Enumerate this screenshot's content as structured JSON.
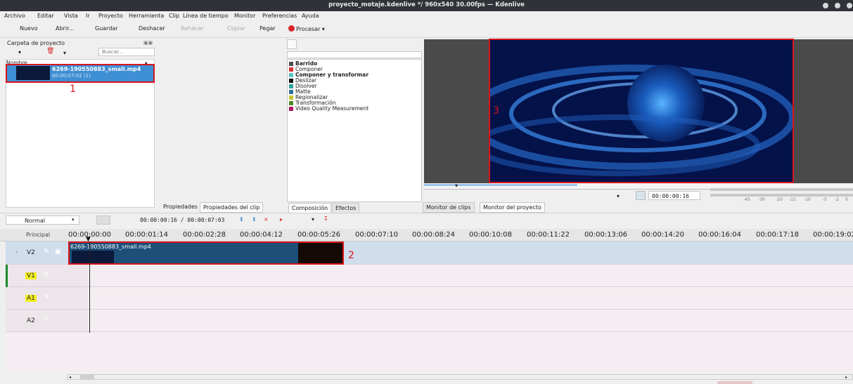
{
  "window": {
    "title": "proyecto_motaje.kdenlive */ 960x540 30.00fps — Kdenlive"
  },
  "menu": [
    "Archivo",
    "Editar",
    "Vista",
    "Ir",
    "Proyecto",
    "Herramienta",
    "Clip",
    "Línea de tiempo",
    "Monitor",
    "Preferencias",
    "Ayuda"
  ],
  "toolbar": {
    "nuevo": "Nuevo",
    "abrir": "Abrir...",
    "guardar": "Guardar",
    "deshacer": "Deshacer",
    "rehacer": "Rehacer",
    "copiar": "Copiar",
    "pegar": "Pegar",
    "procesar": "Procesar"
  },
  "bin": {
    "title": "Carpeta de proyecto",
    "search_placeholder": "Buscar...",
    "column": "Nombre",
    "clip_name": "6269-190550883_small.mp4",
    "clip_duration": "00:00:07:02 (1)"
  },
  "effects": {
    "items": [
      {
        "label": "Barrido",
        "bold": true,
        "color": "#4a4a4a"
      },
      {
        "label": "Componer",
        "bold": false,
        "color": "#d93030"
      },
      {
        "label": "Componer y transformar",
        "bold": true,
        "color": "#58c4c8"
      },
      {
        "label": "Deslizar",
        "bold": false,
        "color": "#111111"
      },
      {
        "label": "Disolver",
        "bold": false,
        "color": "#2aa39a"
      },
      {
        "label": "Matte",
        "bold": false,
        "color": "#2f6f9e"
      },
      {
        "label": "Regionalizar",
        "bold": false,
        "color": "#c8c830"
      },
      {
        "label": "Transformación",
        "bold": false,
        "color": "#4a8a2a"
      },
      {
        "label": "Video Quality Measurement",
        "bold": false,
        "color": "#b0155e"
      }
    ]
  },
  "tabs": {
    "propiedades": "Propiedades",
    "propiedades_clip": "Propiedades del clip",
    "composicion": "Composición",
    "efectos": "Efectos",
    "monitor_clips": "Monitor de clips",
    "monitor_proyecto": "Monitor del proyecto"
  },
  "monitor": {
    "timecode": "00:00:00:16",
    "audio_scale": [
      "-45",
      "-30",
      "-20",
      "-15",
      "-10",
      "-5",
      "-2",
      "0"
    ]
  },
  "timeline": {
    "mode": "Normal",
    "position": "00:00:00:16 / 00:00:07:03",
    "label": "Principal",
    "ruler": [
      "00:00:00:00",
      "00:00:01:14",
      "00:00:02:28",
      "00:00:04:12",
      "00:00:05:26",
      "00:00:07:10",
      "00:00:08:24",
      "00:00:10:08",
      "00:00:11:22",
      "00:00:13:06",
      "00:00:14:20",
      "00:00:16:04",
      "00:00:17:18",
      "00:00:19:02"
    ],
    "tracks": [
      "V2",
      "V1",
      "A1",
      "A2"
    ],
    "clip_label": "6269-190550883_small.mp4"
  },
  "annotations": [
    "1",
    "2",
    "3"
  ],
  "colors": {
    "selection": "#3f8fd4",
    "annotation": "#d9151a",
    "clip": "#1d4f79",
    "track_highlight": "#f3ee1e"
  }
}
